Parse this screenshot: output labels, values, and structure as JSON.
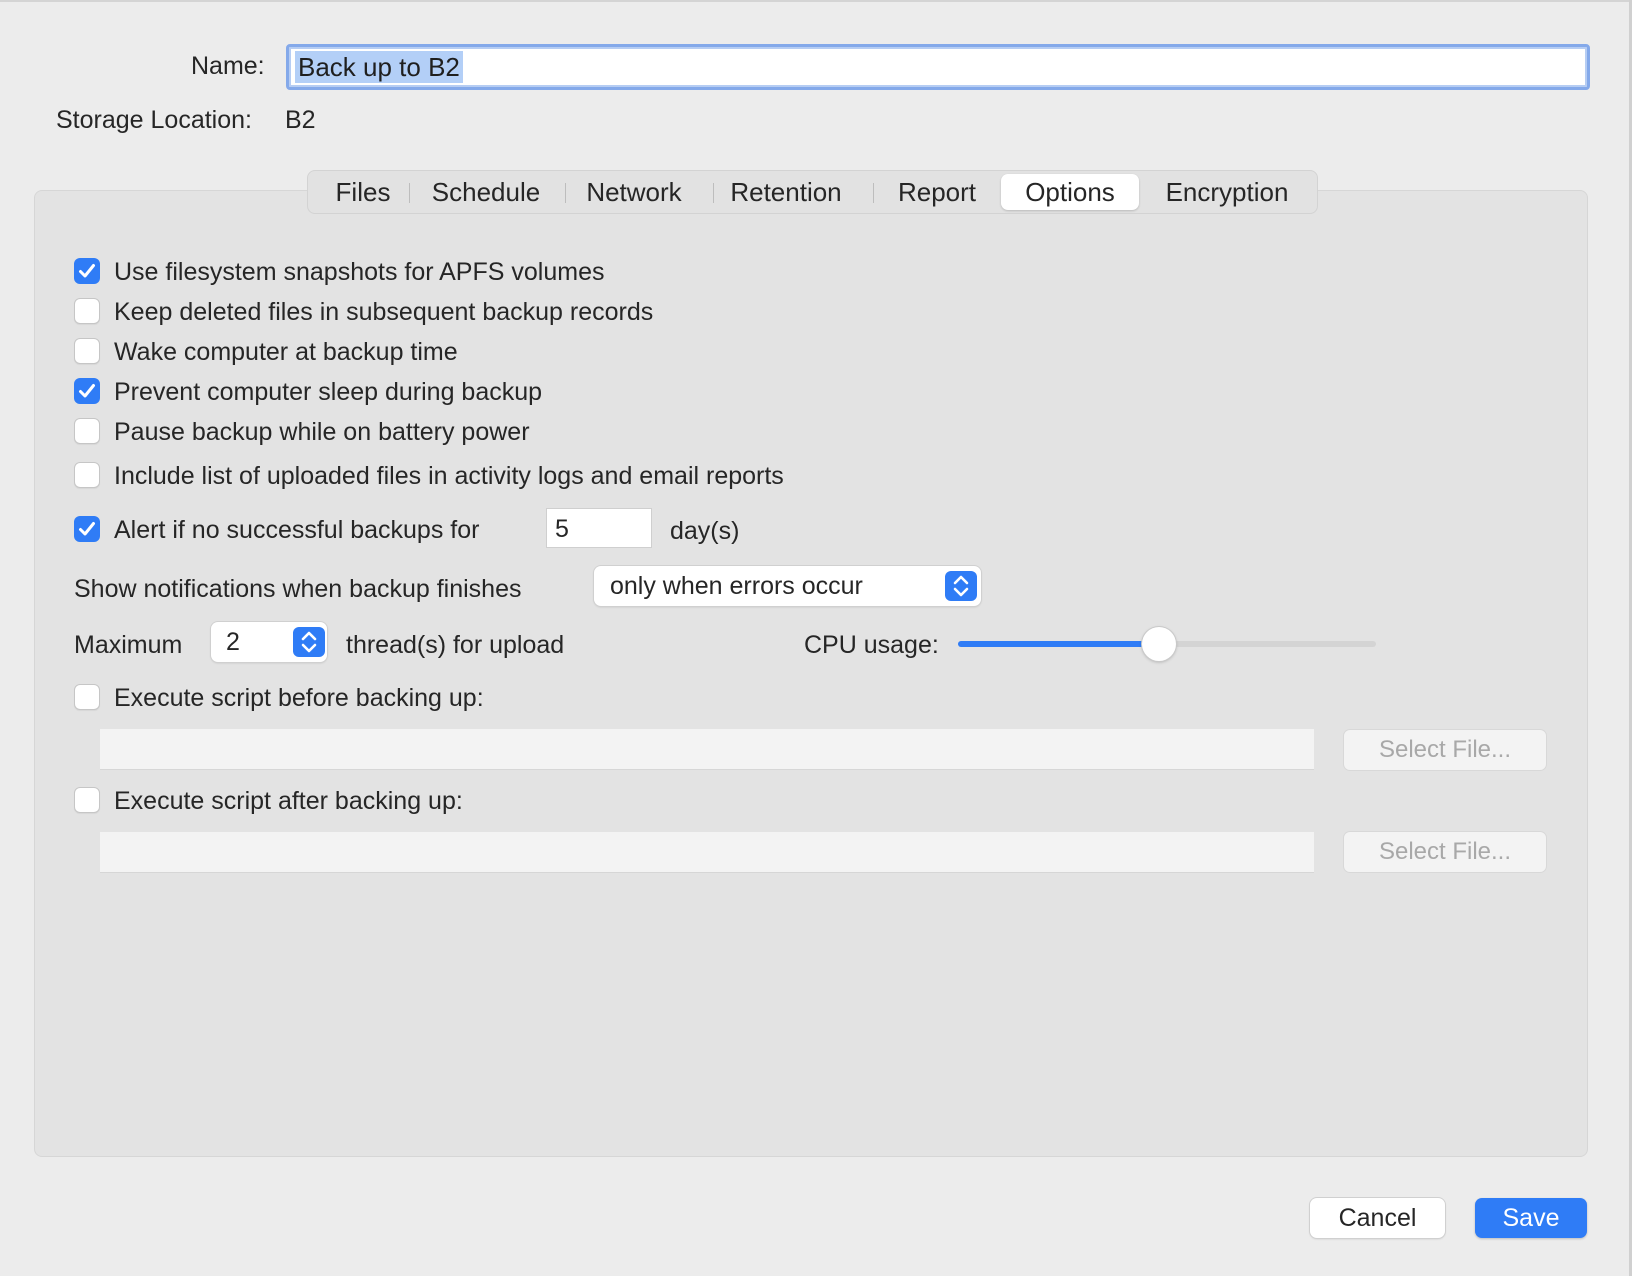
{
  "colors": {
    "accent": "#2f7cf6",
    "panel": "#e3e3e3",
    "window": "#ececec",
    "disabled_text": "#a8a8a8"
  },
  "header": {
    "name_label": "Name:",
    "name_value": "Back up to B2",
    "storage_label": "Storage Location:",
    "storage_value": "B2"
  },
  "tabs": [
    {
      "label": "Files",
      "active": false
    },
    {
      "label": "Schedule",
      "active": false
    },
    {
      "label": "Network",
      "active": false
    },
    {
      "label": "Retention",
      "active": false
    },
    {
      "label": "Report",
      "active": false
    },
    {
      "label": "Options",
      "active": true
    },
    {
      "label": "Encryption",
      "active": false
    }
  ],
  "options": {
    "checkboxes": [
      {
        "label": "Use filesystem snapshots for APFS volumes",
        "checked": true
      },
      {
        "label": "Keep deleted files in subsequent backup records",
        "checked": false
      },
      {
        "label": "Wake computer at backup time",
        "checked": false
      },
      {
        "label": "Prevent computer sleep during backup",
        "checked": true
      },
      {
        "label": "Pause backup while on battery power",
        "checked": false
      },
      {
        "label": "Include list of uploaded files in activity logs and email reports",
        "checked": false
      }
    ],
    "alert": {
      "label": "Alert if no successful backups for",
      "checked": true,
      "value": "5",
      "unit": "day(s)"
    },
    "notifications": {
      "label": "Show notifications when backup finishes",
      "selected": "only when errors occur"
    },
    "threads": {
      "prefix": "Maximum",
      "value": "2",
      "suffix": "thread(s) for upload"
    },
    "cpu": {
      "label": "CPU usage:",
      "level": 0.48
    },
    "script_before": {
      "label": "Execute script before backing up:",
      "checked": false,
      "path": "",
      "button": "Select File..."
    },
    "script_after": {
      "label": "Execute script after backing up:",
      "checked": false,
      "path": "",
      "button": "Select File..."
    }
  },
  "footer": {
    "cancel": "Cancel",
    "save": "Save"
  }
}
